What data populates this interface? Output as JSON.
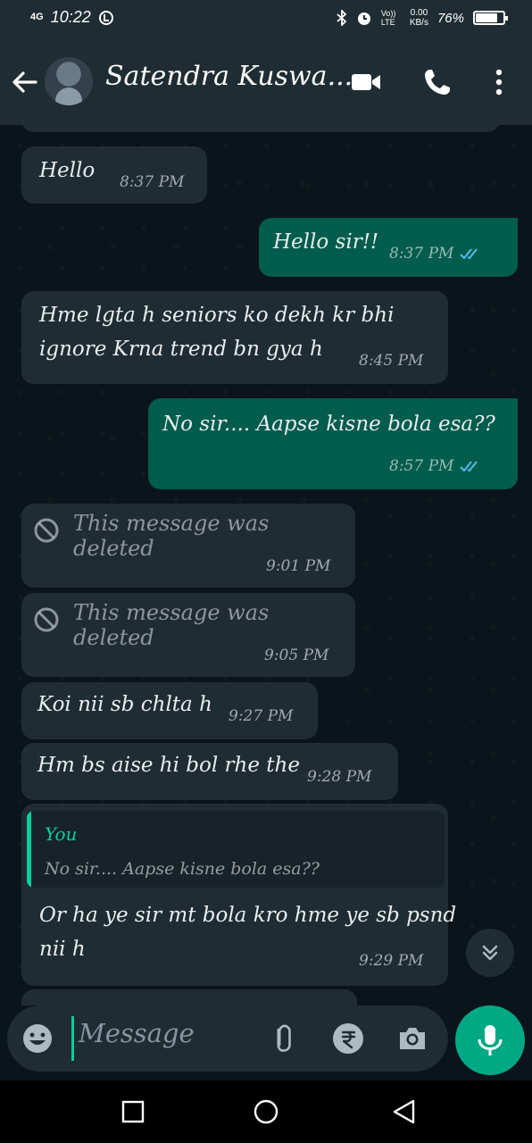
{
  "status_bar": {
    "network": "4G",
    "time": "10:22",
    "data_speed_top": "0.00",
    "data_speed_unit": "KB/s",
    "volte": "Vo)) LTE",
    "battery": "76%",
    "battery_level": 0.76
  },
  "header": {
    "contact_name": "Satendra Kuswa...",
    "icons": [
      "back-arrow-icon",
      "video-call-icon",
      "voice-call-icon",
      "more-vert-icon"
    ]
  },
  "messages": [
    {
      "direction": "in",
      "text": "Hello",
      "time": "8:37 PM"
    },
    {
      "direction": "out",
      "text": "Hello sir!!",
      "time": "8:37 PM",
      "status": "read"
    },
    {
      "direction": "in",
      "line1": "Hme lgta h seniors ko dekh kr bhi",
      "line2": "ignore Krna trend bn gya h",
      "time": "8:45 PM"
    },
    {
      "direction": "out",
      "text": "No sir.... Aapse kisne bola esa??",
      "time": "8:57 PM",
      "status": "read"
    },
    {
      "direction": "in",
      "deleted": true,
      "text": "This message was deleted",
      "time": "9:01 PM"
    },
    {
      "direction": "in",
      "deleted": true,
      "text": "This message was deleted",
      "time": "9:05 PM"
    },
    {
      "direction": "in",
      "text": "Koi nii sb chlta h",
      "time": "9:27 PM"
    },
    {
      "direction": "in",
      "text": "Hm bs aise hi bol rhe the",
      "time": "9:28 PM"
    },
    {
      "direction": "in",
      "quote_author": "You",
      "quote_text": "No sir.... Aapse kisne bola esa??",
      "line1": "Or ha ye sir mt bola kro hme ye sb psnd",
      "line2": "nii h",
      "time": "9:29 PM"
    }
  ],
  "input": {
    "placeholder": "Message",
    "icons": [
      "emoji-icon",
      "attach-icon",
      "rupee-payment-icon",
      "camera-icon",
      "mic-icon"
    ]
  },
  "colors": {
    "header_bg": "#1f2c33",
    "chat_bg": "#0b141a",
    "incoming_bubble": "#1f2c33",
    "outgoing_bubble": "#005c4b",
    "accent": "#00a884",
    "read_ticks": "#53bdeb"
  }
}
